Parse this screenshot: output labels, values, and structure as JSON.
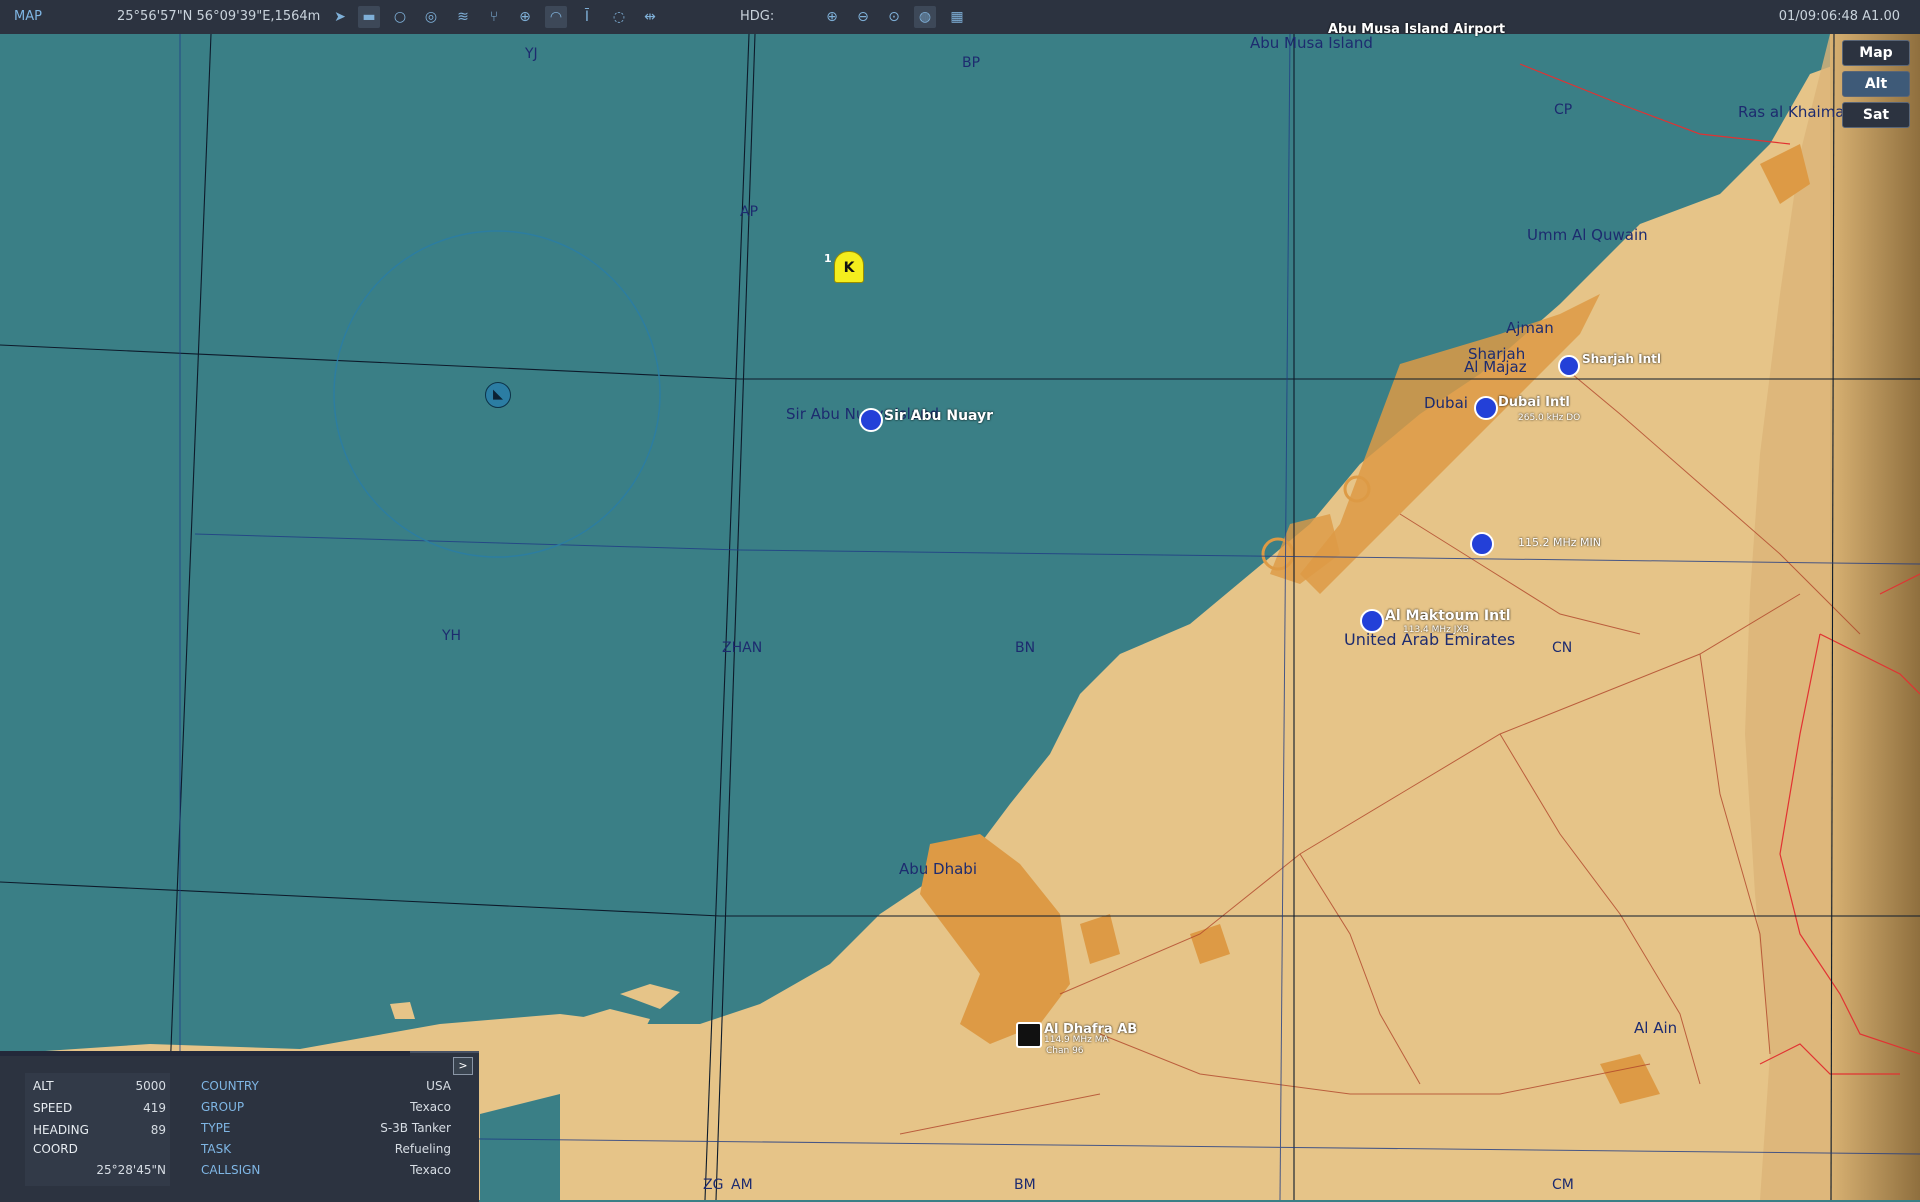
{
  "topbar": {
    "map_label": "MAP",
    "coordinates": "25°56'57\"N 56°09'39\"E,1564m",
    "hdg_label": "HDG:",
    "time": "01/09:06:48 A1.00",
    "icons": [
      "route-icon",
      "ruler-icon",
      "circle-icon",
      "layers-icon",
      "wind-icon",
      "network-icon",
      "crosshair-icon",
      "signal-icon",
      "tower-icon",
      "chat-icon",
      "split-icon",
      "zoom-in-icon",
      "zoom-out-icon",
      "zoom-fit-icon",
      "globe-icon",
      "grid-icon"
    ]
  },
  "views": {
    "map": "Map",
    "alt": "Alt",
    "sat": "Sat",
    "selected": "Alt"
  },
  "grid_labels": [
    "YJ",
    "BP",
    "CP",
    "AP",
    "YH",
    "ZHAN",
    "BN",
    "CN",
    "ZG",
    "AM",
    "BM",
    "CM"
  ],
  "places": {
    "abu_musa": "Abu Musa Island",
    "abu_musa_airport": "Abu Musa Island Airport",
    "ras_al_khaimah": "Ras al Khaimah",
    "umm_al_quwain": "Umm Al Quwain",
    "ajman": "Ajman",
    "sharjah": "Sharjah",
    "al_majaz": "Al Majaz",
    "dubai": "Dubai",
    "sir_abu_nuayr_island": "Sir Abu Nuayr Island",
    "uae": "United Arab Emirates",
    "abu_dhabi": "Abu Dhabi",
    "al_ain": "Al Ain"
  },
  "airports": {
    "sir_abu_nuayr": "Sir Abu Nuayr",
    "dubai_intl": "Dubai Intl",
    "dubai_freq": "265.0 kHz DO",
    "sharjah_intl": "Sharjah Intl",
    "al_minhad": "115.2 MHz MIN",
    "al_maktoum": "Al Maktoum Intl",
    "al_maktoum_freq": "113.4 MHz JXB",
    "al_dhafra": "Al Dhafra AB",
    "al_dhafra_freq": "114.9 MHz MA",
    "al_dhafra_chan": "Chan 96"
  },
  "tanker_marker": {
    "letter": "K",
    "index": "1"
  },
  "info_panel": {
    "toggle": ">",
    "left": [
      {
        "key": "ALT",
        "value": "5000"
      },
      {
        "key": "SPEED",
        "value": "419"
      },
      {
        "key": "HEADING",
        "value": "89"
      },
      {
        "key": "COORD",
        "value": ""
      }
    ],
    "coord_value": "25°28'45\"N",
    "right": [
      {
        "key": "COUNTRY",
        "value": "USA"
      },
      {
        "key": "GROUP",
        "value": "Texaco"
      },
      {
        "key": "TYPE",
        "value": "S-3B Tanker"
      },
      {
        "key": "TASK",
        "value": "Refueling"
      },
      {
        "key": "CALLSIGN",
        "value": "Texaco"
      }
    ]
  },
  "colors": {
    "sea": "#3a7f86",
    "land": "#e6c488",
    "urban": "#dd9a45",
    "toolbar": "#2c3340",
    "label": "#1d2b6f",
    "tanker": "#f4ee1d"
  }
}
